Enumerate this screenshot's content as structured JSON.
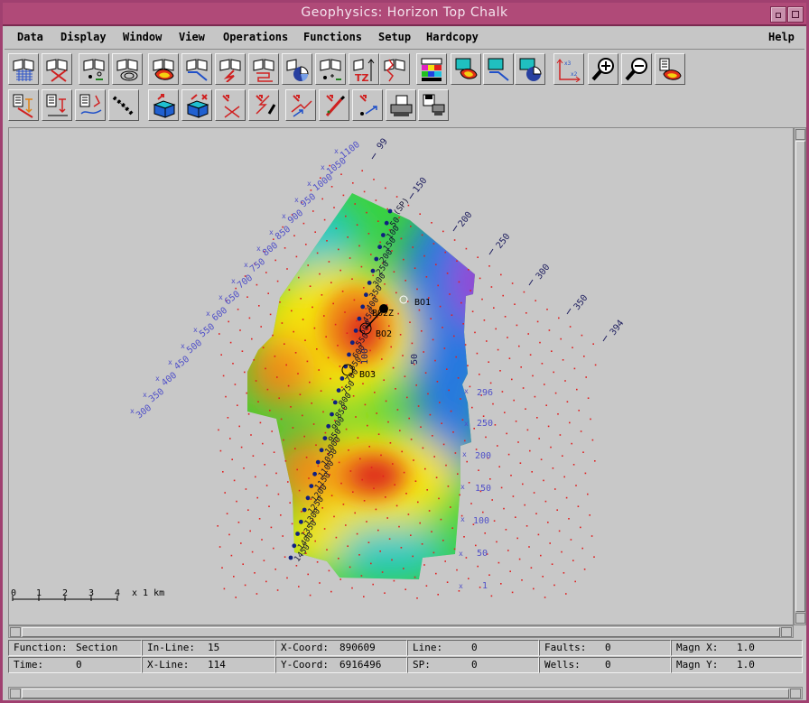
{
  "window": {
    "title": "Geophysics: Horizon Top Chalk"
  },
  "menubar": {
    "items": [
      "Data",
      "Display",
      "Window",
      "View",
      "Operations",
      "Functions",
      "Setup",
      "Hardcopy"
    ],
    "help": "Help"
  },
  "toolbar": {
    "row1": [
      "open-grid-icon",
      "close-section-icon",
      "well-select-icon",
      "well-contour-icon",
      "horizon-map-icon",
      "section-line-icon",
      "fault-icon",
      "polyline-icon",
      "piechart-icon",
      "well-tops-icon",
      "tz-icon",
      "log-curve-icon",
      "colorbar-icon",
      "map-display-icon",
      "line-display-icon",
      "pie-display-icon",
      "axis-scale-icon",
      "zoom-in-icon",
      "zoom-out-icon",
      "calculator-map-icon"
    ],
    "row2": [
      "calc-depth-icon",
      "calc-time-icon",
      "calc-curve-icon",
      "path-points-icon",
      "surface-3d-icon",
      "surface-3d-edit-icon",
      "delete-fault-icon",
      "draw-fault-icon",
      "digitize-line-icon",
      "edit-line-icon",
      "point-pick-icon",
      "print-icon",
      "save-print-icon"
    ]
  },
  "map": {
    "inline_labels_left": [
      "1100",
      "1050",
      "1000",
      "950",
      "900",
      "850",
      "800",
      "750",
      "700",
      "650",
      "600",
      "550",
      "500",
      "450",
      "400",
      "350",
      "300"
    ],
    "xline_labels_top": [
      "99",
      "150",
      "200",
      "250",
      "300",
      "350",
      "394"
    ],
    "inline_labels_right": [
      "296",
      "250",
      "200",
      "150",
      "100",
      "50",
      "1"
    ],
    "shotpoints": [
      "(SP)",
      "50",
      "100",
      "150",
      "200",
      "250",
      "300",
      "350",
      "400",
      "450",
      "500",
      "550",
      "600",
      "650",
      "700",
      "750",
      "800",
      "850",
      "900",
      "950",
      "1000",
      "1050",
      "1100",
      "1150",
      "1200",
      "1250",
      "1300",
      "1350",
      "1400",
      "1450"
    ],
    "wells": [
      "BO1",
      "BO2Z",
      "BO2",
      "BO3"
    ],
    "contour_labels": [
      "100",
      "50"
    ],
    "scale": {
      "ticks": [
        "0",
        "1",
        "2",
        "3",
        "4"
      ],
      "unit": "x 1 km"
    }
  },
  "status": {
    "function_label": "Function:",
    "function_value": "Section",
    "inline_label": "In-Line:",
    "inline_value": "15",
    "xcoord_label": "X-Coord:",
    "xcoord_value": "890609",
    "line_label": "Line:",
    "line_value": "0",
    "faults_label": "Faults:",
    "faults_value": "0",
    "magnx_label": "Magn X:",
    "magnx_value": "1.0",
    "time_label": "Time:",
    "time_value": "0",
    "xline_label": "X-Line:",
    "xline_value": "114",
    "ycoord_label": "Y-Coord:",
    "ycoord_value": "6916496",
    "sp_label": "SP:",
    "sp_value": "0",
    "wells_label": "Wells:",
    "wells_value": "0",
    "magny_label": "Magn Y:",
    "magny_value": "1.0"
  },
  "colors": {
    "titlebar": "#b04a78",
    "red": "#e0301a",
    "orange": "#f08a18",
    "yellow": "#f4e410",
    "green": "#3cd23c",
    "cyan": "#28c8c8",
    "blue": "#2878e0",
    "purple": "#9a3cd8"
  }
}
